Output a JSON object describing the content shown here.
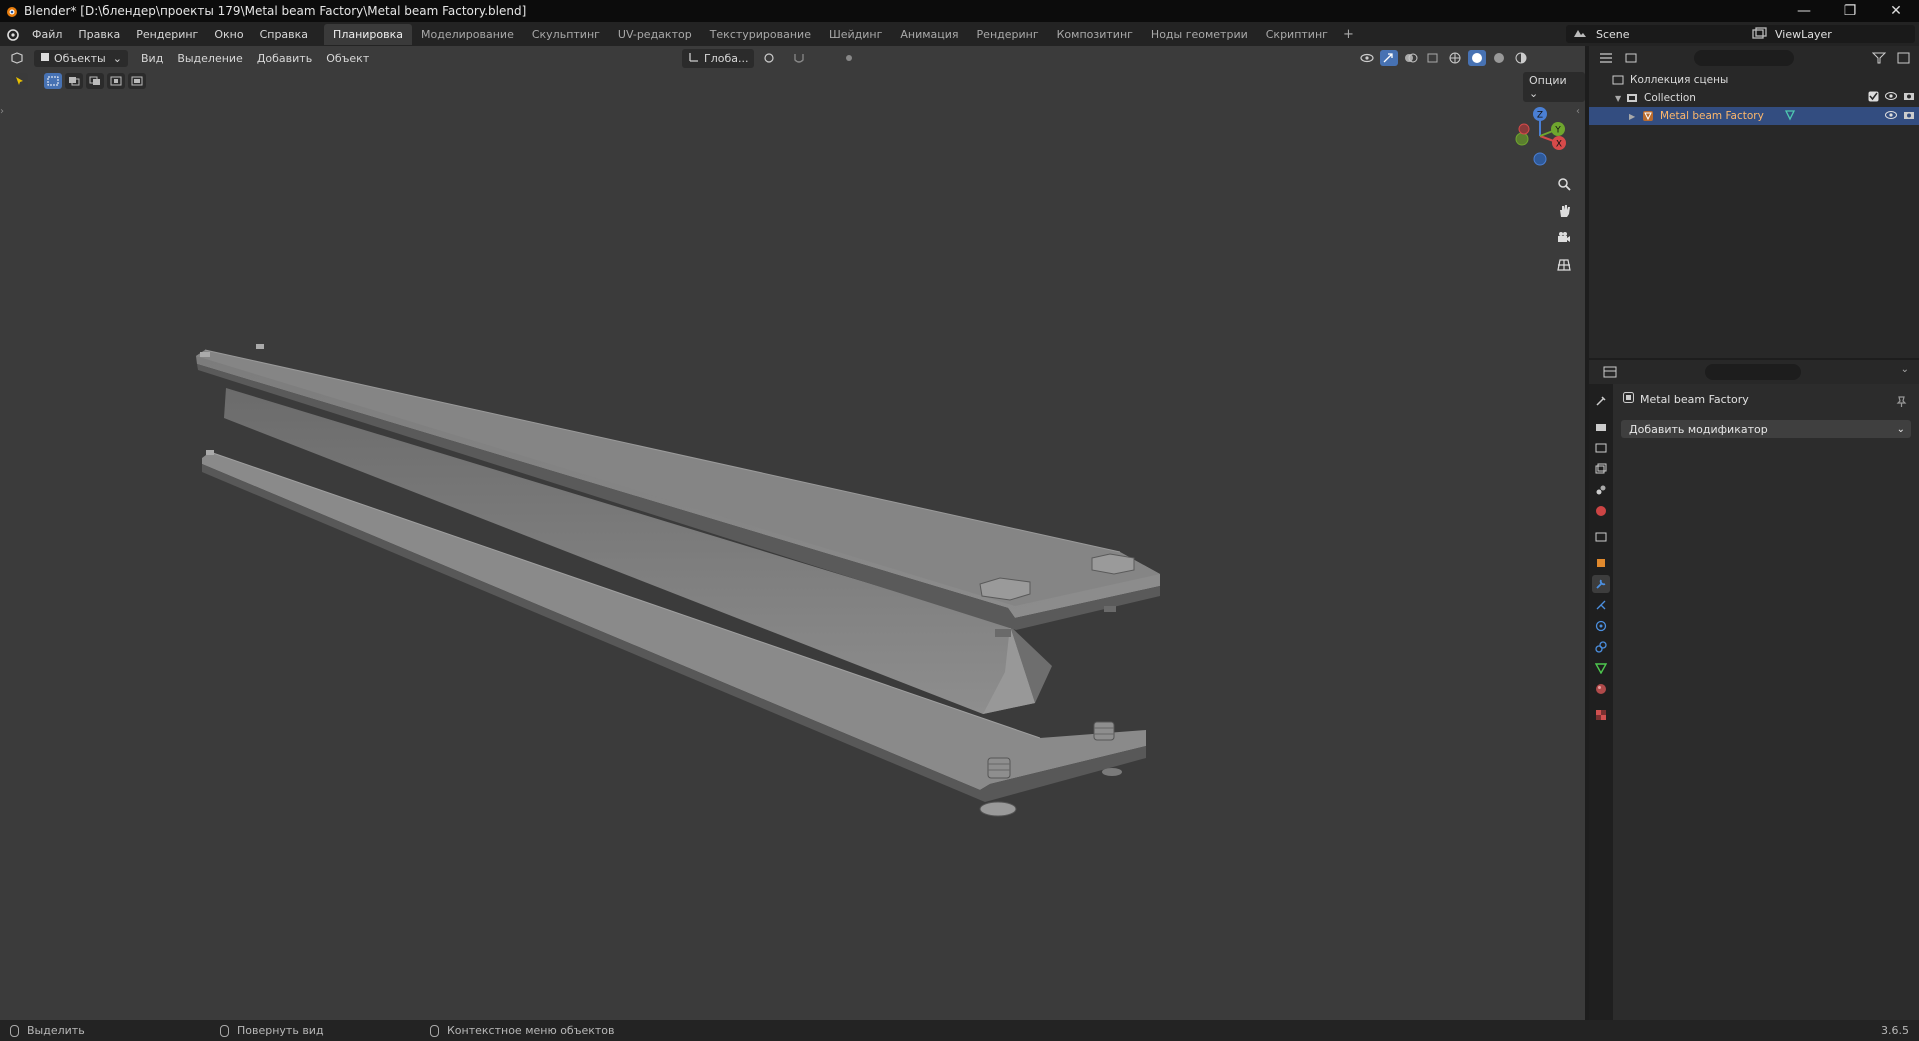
{
  "window": {
    "title": "Blender* [D:\\блендер\\проекты 179\\Metal beam Factory\\Metal beam Factory.blend]",
    "minimize": "—",
    "maximize": "❐",
    "close": "✕"
  },
  "menu": [
    "Файл",
    "Правка",
    "Рендеринг",
    "Окно",
    "Справка"
  ],
  "workspaces": [
    "Планировка",
    "Моделирование",
    "Скульптинг",
    "UV-редактор",
    "Текстурирование",
    "Шейдинг",
    "Анимация",
    "Рендеринг",
    "Композитинг",
    "Ноды геометрии",
    "Скриптинг"
  ],
  "workspace_add": "+",
  "scene": "Scene",
  "view_layer": "ViewLayer",
  "viewport": {
    "mode": "Объекты",
    "menus": [
      "Вид",
      "Выделение",
      "Добавить",
      "Объект"
    ],
    "transform_orientation": "Глоба...",
    "options": "Опции",
    "gizmo": {
      "x": "X",
      "y": "Y",
      "z": "Z"
    }
  },
  "outliner": {
    "root": "Коллекция сцены",
    "collection": "Collection",
    "object": "Metal beam Factory"
  },
  "properties": {
    "object_name": "Metal beam Factory",
    "add_modifier": "Добавить модификатор"
  },
  "status": {
    "select": "Выделить",
    "rotate": "Повернуть вид",
    "context": "Контекстное меню объектов",
    "version": "3.6.5"
  },
  "colors": {
    "accent": "#4772b3",
    "selected_row": "#334d80",
    "viewport_bg": "#3b3b3b",
    "beam": "#8a8a8a"
  }
}
